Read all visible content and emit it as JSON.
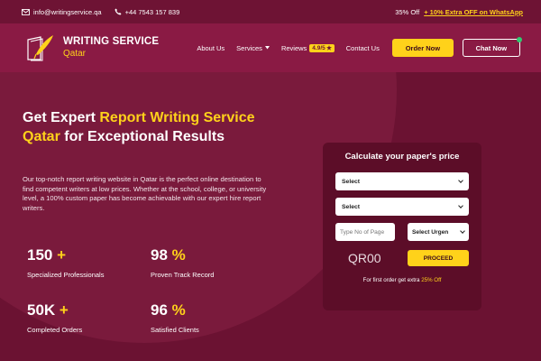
{
  "topbar": {
    "email": "info@writingservice.qa",
    "phone": "+44 7543 157 839",
    "promo_off": "35% Off",
    "promo_plus": "+ 10% Extra OFF on WhatsApp"
  },
  "header": {
    "logo_title": "WRITING SERVICE",
    "logo_sub": "Qatar",
    "nav": {
      "about": "About Us",
      "services": "Services",
      "reviews": "Reviews",
      "reviews_badge": "4.9/5",
      "contact": "Contact Us"
    },
    "order_label": "Order Now",
    "chat_label": "Chat Now"
  },
  "hero": {
    "title_1": "Get Expert ",
    "title_hl": "Report Writing Service Qatar",
    "title_2": " for Exceptional Results",
    "description": "Our top-notch report writing website in Qatar is the perfect online destination to find competent writers at low prices. Whether at the school, college, or university level, a 100% custom paper has become achievable with our expert hire report writers.",
    "stats": [
      {
        "num": "150",
        "suffix": "+",
        "label": "Specialized Professionals"
      },
      {
        "num": "98",
        "suffix": "%",
        "label": "Proven Track Record"
      },
      {
        "num": "50K",
        "suffix": "+",
        "label": "Completed Orders"
      },
      {
        "num": "96",
        "suffix": "%",
        "label": "Satisfied Clients"
      }
    ]
  },
  "calculator": {
    "title": "Calculate your paper's price",
    "select_1": "Select",
    "select_2": "Select",
    "pages_placeholder": "Type No of Page",
    "urgency": "Select Urgen",
    "price": "QR00",
    "proceed_label": "PROCEED",
    "note": "For first order get extra ",
    "note_hl": "25% Off"
  },
  "colors": {
    "brand": "#8a1a44",
    "accent": "#ffd21a",
    "background": "#6b1232"
  }
}
